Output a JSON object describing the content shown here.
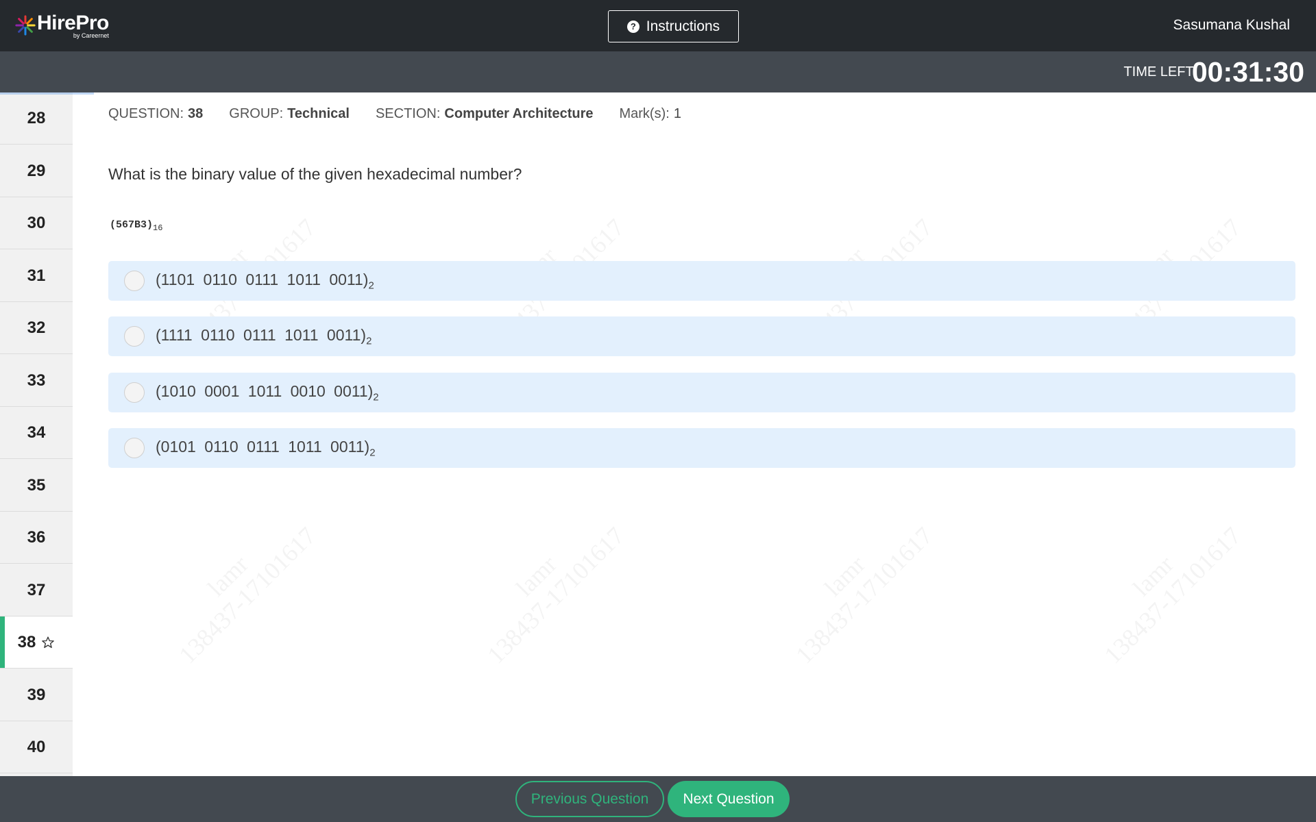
{
  "header": {
    "logo_name": "HirePro",
    "logo_sub": "by Careernet",
    "instructions_label": "Instructions",
    "username": "Sasumana Kushal"
  },
  "timer": {
    "label": "TIME LEFT:",
    "value": "00:31:30"
  },
  "sidebar": {
    "items": [
      {
        "number": "28"
      },
      {
        "number": "29"
      },
      {
        "number": "30"
      },
      {
        "number": "31"
      },
      {
        "number": "32"
      },
      {
        "number": "33"
      },
      {
        "number": "34"
      },
      {
        "number": "35"
      },
      {
        "number": "36"
      },
      {
        "number": "37"
      },
      {
        "number": "38"
      },
      {
        "number": "39"
      },
      {
        "number": "40"
      }
    ],
    "active": "38"
  },
  "meta": {
    "question_label": "QUESTION:",
    "question_value": "38",
    "group_label": "GROUP:",
    "group_value": "Technical",
    "section_label": "SECTION:",
    "section_value": "Computer Architecture",
    "marks_label": "Mark(s):",
    "marks_value": "1"
  },
  "question": {
    "text": "What is the binary value of the given hexadecimal number?",
    "hex": "(567B3)",
    "hex_base": "16"
  },
  "options": [
    {
      "text": "(1101 0110 0111 1011 0011)",
      "base": "2"
    },
    {
      "text": "(1111 0110 0111 1011 0011)",
      "base": "2"
    },
    {
      "text": "(1010 0001 1011 0010 0011)",
      "base": "2"
    },
    {
      "text": "(0101 0110 0111 1011 0011)",
      "base": "2"
    }
  ],
  "watermark": {
    "line1": "lamr",
    "line2": "138437-17101617"
  },
  "footer": {
    "prev_label": "Previous Question",
    "next_label": "Next Question"
  },
  "colors": {
    "header_bg": "#25292d",
    "subheader_bg": "#434950",
    "accent_green": "#2fb47c",
    "option_bg": "#e3f0fd"
  },
  "icons": {
    "instructions": "question-circle-icon",
    "bookmark": "star-outline-icon",
    "logo": "colorful-burst-logo"
  }
}
